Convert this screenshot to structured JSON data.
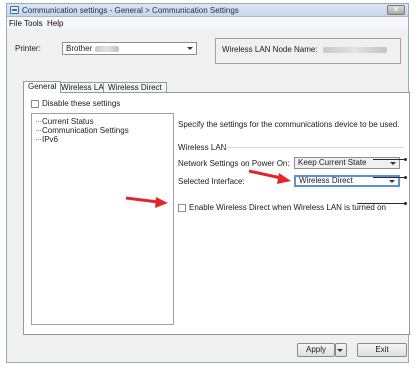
{
  "window": {
    "title": "Communication settings - General > Communication Settings",
    "close_glyph": "✕",
    "icon": "printer-settings-app-icon"
  },
  "menu": [
    "File",
    "Tools",
    "Help"
  ],
  "printer": {
    "label": "Printer:",
    "selected": "Brother"
  },
  "node": {
    "label": "Wireless LAN Node Name:"
  },
  "tabs": [
    {
      "label": "General",
      "active": true
    },
    {
      "label": "Wireless LAN",
      "active": false
    },
    {
      "label": "Wireless Direct",
      "active": false
    }
  ],
  "disable": {
    "label": "Disable these settings",
    "checked": false
  },
  "tree": [
    "Current Status",
    "Communication Settings",
    "IPv6"
  ],
  "main": {
    "description": "Specify the settings for the communications device to be used.",
    "group_title": "Wireless LAN",
    "network_on_power": {
      "label": "Network Settings on Power On:",
      "value": "Keep Current State"
    },
    "selected_interface": {
      "label": "Selected Interface:",
      "value": "Wireless Direct"
    },
    "enable_wd": {
      "label": "Enable Wireless Direct when Wireless LAN is turned on",
      "checked": false
    }
  },
  "buttons": {
    "apply": "Apply",
    "exit": "Exit"
  },
  "colors": {
    "annotation_arrow": "#e3262b",
    "focus_border": "#5b8fd6"
  }
}
